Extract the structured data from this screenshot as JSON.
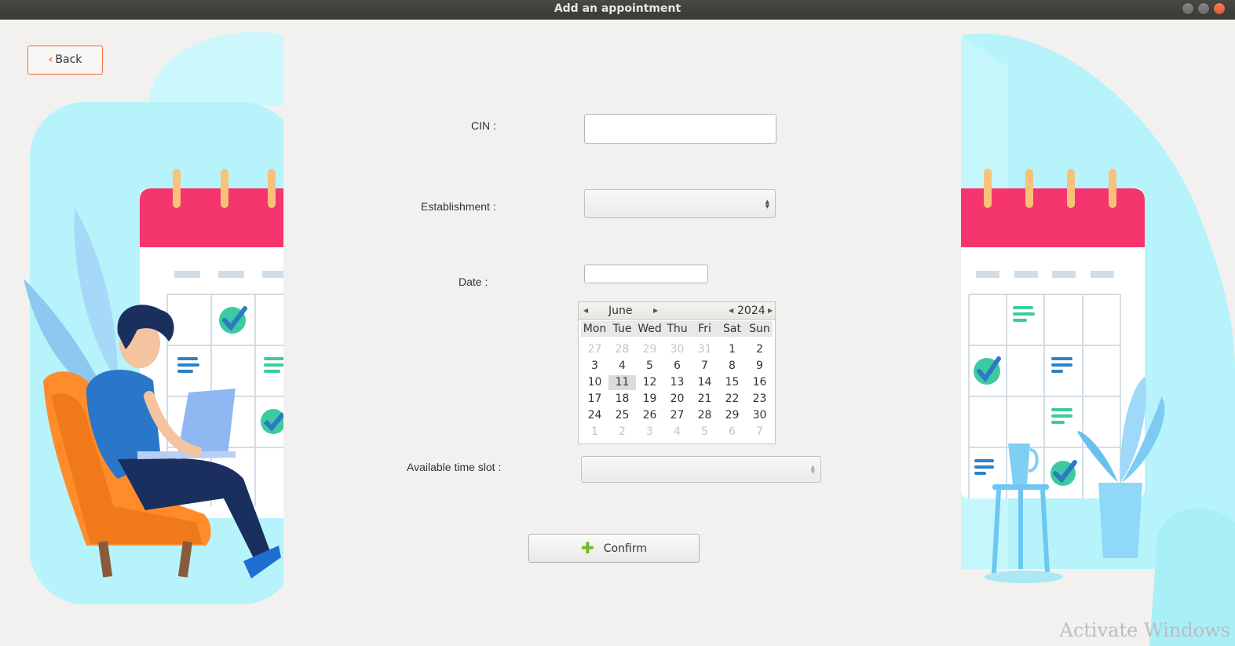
{
  "window": {
    "title": "Add an appointment"
  },
  "back_button": {
    "label": "Back"
  },
  "form": {
    "cin_label": "CIN :",
    "cin_value": "",
    "establishment_label": "Establishment :",
    "establishment_value": "",
    "date_label": "Date :",
    "date_value": "",
    "time_slot_label": "Available time slot :",
    "time_slot_value": ""
  },
  "calendar": {
    "month": "June",
    "year": "2024",
    "selected_day": "11",
    "weekdays": [
      "Mon",
      "Tue",
      "Wed",
      "Thu",
      "Fri",
      "Sat",
      "Sun"
    ],
    "weeks": [
      [
        "27",
        "28",
        "29",
        "30",
        "31",
        "1",
        "2"
      ],
      [
        "3",
        "4",
        "5",
        "6",
        "7",
        "8",
        "9"
      ],
      [
        "10",
        "11",
        "12",
        "13",
        "14",
        "15",
        "16"
      ],
      [
        "17",
        "18",
        "19",
        "20",
        "21",
        "22",
        "23"
      ],
      [
        "24",
        "25",
        "26",
        "27",
        "28",
        "29",
        "30"
      ],
      [
        "1",
        "2",
        "3",
        "4",
        "5",
        "6",
        "7"
      ]
    ],
    "other_month_cells": [
      [
        0,
        0
      ],
      [
        0,
        1
      ],
      [
        0,
        2
      ],
      [
        0,
        3
      ],
      [
        0,
        4
      ],
      [
        5,
        0
      ],
      [
        5,
        1
      ],
      [
        5,
        2
      ],
      [
        5,
        3
      ],
      [
        5,
        4
      ],
      [
        5,
        5
      ],
      [
        5,
        6
      ]
    ]
  },
  "confirm_button": {
    "label": "Confirm",
    "icon": "plus-icon"
  },
  "watermark": {
    "text": "Activate Windows"
  },
  "colors": {
    "accent": "#e8703f",
    "calendar_top": "#f5356e",
    "illustration_bg": "#b6f3fb"
  }
}
